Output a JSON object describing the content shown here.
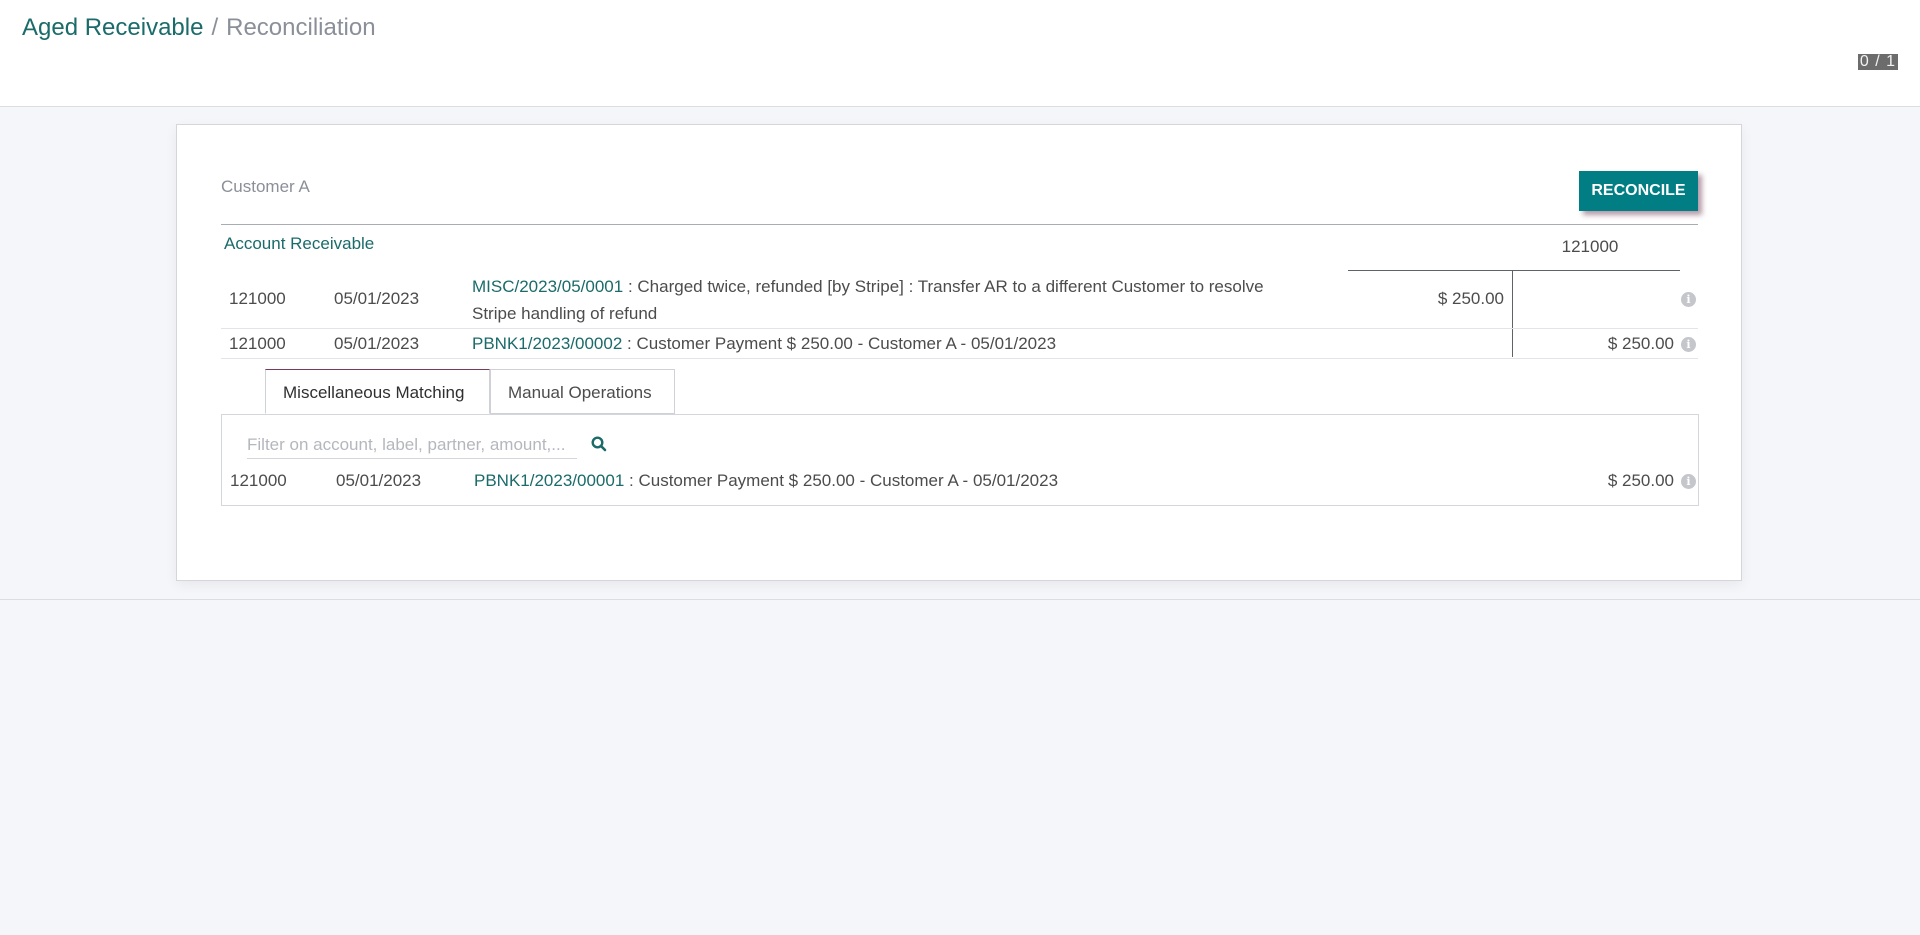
{
  "breadcrumb": {
    "parent": "Aged Receivable",
    "separator": "/",
    "current": "Reconciliation"
  },
  "pager": {
    "value": "0 / 1"
  },
  "reconciliation": {
    "partner": "Customer A",
    "reconcile_label": "RECONCILE",
    "account_title": "Account Receivable",
    "account_code": "121000",
    "lines": [
      {
        "account": "121000",
        "date": "05/01/2023",
        "ref": "MISC/2023/05/0001",
        "label": " : Charged twice, refunded [by Stripe] : Transfer AR to a different Customer to resolve Stripe handling of refund",
        "debit": "$ 250.00",
        "credit": ""
      },
      {
        "account": "121000",
        "date": "05/01/2023",
        "ref": "PBNK1/2023/00002",
        "label": " : Customer Payment $ 250.00 - Customer A - 05/01/2023",
        "debit": "",
        "credit": "$ 250.00"
      }
    ],
    "info_glyph": "i"
  },
  "tabs": [
    {
      "label": "Miscellaneous Matching",
      "active": true
    },
    {
      "label": "Manual Operations",
      "active": false
    }
  ],
  "matching": {
    "filter_placeholder": "Filter on account, label, partner, amount,...",
    "filter_value": "",
    "search_icon": "search-icon",
    "rows": [
      {
        "account": "121000",
        "date": "05/01/2023",
        "ref": "PBNK1/2023/00001",
        "label": " : Customer Payment $ 250.00 - Customer A - 05/01/2023",
        "amount": "$ 250.00"
      }
    ]
  },
  "colors": {
    "accent": "#017e84",
    "link": "#1a6b6a",
    "background": "#f5f6fa"
  }
}
